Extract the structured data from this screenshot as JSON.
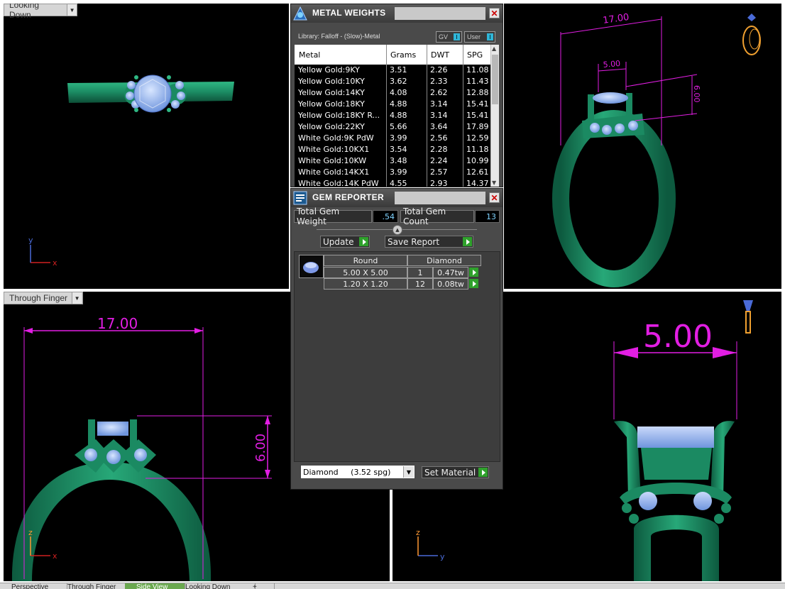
{
  "viewports": {
    "top_left": {
      "label": "Looking Down"
    },
    "bottom_left": {
      "label": "Through Finger",
      "dimensions": {
        "width": "17.00",
        "height": "6.00"
      }
    },
    "top_right": {
      "dimensions": {
        "width": "17.00",
        "stone": "5.00",
        "height": "6.00"
      }
    },
    "bottom_right": {
      "dimensions": {
        "stone": "5.00"
      }
    }
  },
  "axes": {
    "x": "x",
    "y": "y",
    "z": "z"
  },
  "metal_weights": {
    "title": "METAL WEIGHTS",
    "library": "Library: Falloff - (Slow)-Metal",
    "toggle_gv": "GV",
    "toggle_user": "User",
    "toggle_mark": "I",
    "close": "✕",
    "columns": [
      "Metal",
      "Grams",
      "DWT",
      "SPG"
    ],
    "rows": [
      [
        "Yellow Gold:9KY",
        "3.51",
        "2.26",
        "11.08"
      ],
      [
        "Yellow Gold:10KY",
        "3.62",
        "2.33",
        "11.43"
      ],
      [
        "Yellow Gold:14KY",
        "4.08",
        "2.62",
        "12.88"
      ],
      [
        "Yellow Gold:18KY",
        "4.88",
        "3.14",
        "15.41"
      ],
      [
        "Yellow Gold:18KY R...",
        "4.88",
        "3.14",
        "15.41"
      ],
      [
        "Yellow Gold:22KY",
        "5.66",
        "3.64",
        "17.89"
      ],
      [
        "White Gold:9K PdW",
        "3.99",
        "2.56",
        "12.59"
      ],
      [
        "White Gold:10KX1",
        "3.54",
        "2.28",
        "11.18"
      ],
      [
        "White Gold:10KW",
        "3.48",
        "2.24",
        "10.99"
      ],
      [
        "White Gold:14KX1",
        "3.99",
        "2.57",
        "12.61"
      ],
      [
        "White Gold:14K PdW",
        "4.55",
        "2.93",
        "14.37"
      ]
    ]
  },
  "gem_reporter": {
    "title": "GEM REPORTER",
    "close": "✕",
    "total_weight_label": "Total Gem Weight",
    "total_weight_value": ".54",
    "total_count_label": "Total Gem Count",
    "total_count_value": "13",
    "update_label": "Update",
    "save_label": "Save Report",
    "shape": "Round",
    "material": "Diamond",
    "gems": [
      {
        "size": "5.00 X 5.00",
        "count": "1",
        "weight": "0.47tw"
      },
      {
        "size": "1.20 X 1.20",
        "count": "12",
        "weight": "0.08tw"
      }
    ],
    "material_select": "Diamond     (3.52 spg)",
    "set_material_label": "Set Material"
  },
  "tabs": [
    "Perspective",
    "Through Finger",
    "Side View",
    "Looking Down",
    "+"
  ],
  "colors": {
    "ring": "#1c8b62",
    "gem": "#8fb4f0",
    "dimension": "#e21ee3",
    "axis_x": "#d02020",
    "axis_y": "#4a6bd8"
  }
}
